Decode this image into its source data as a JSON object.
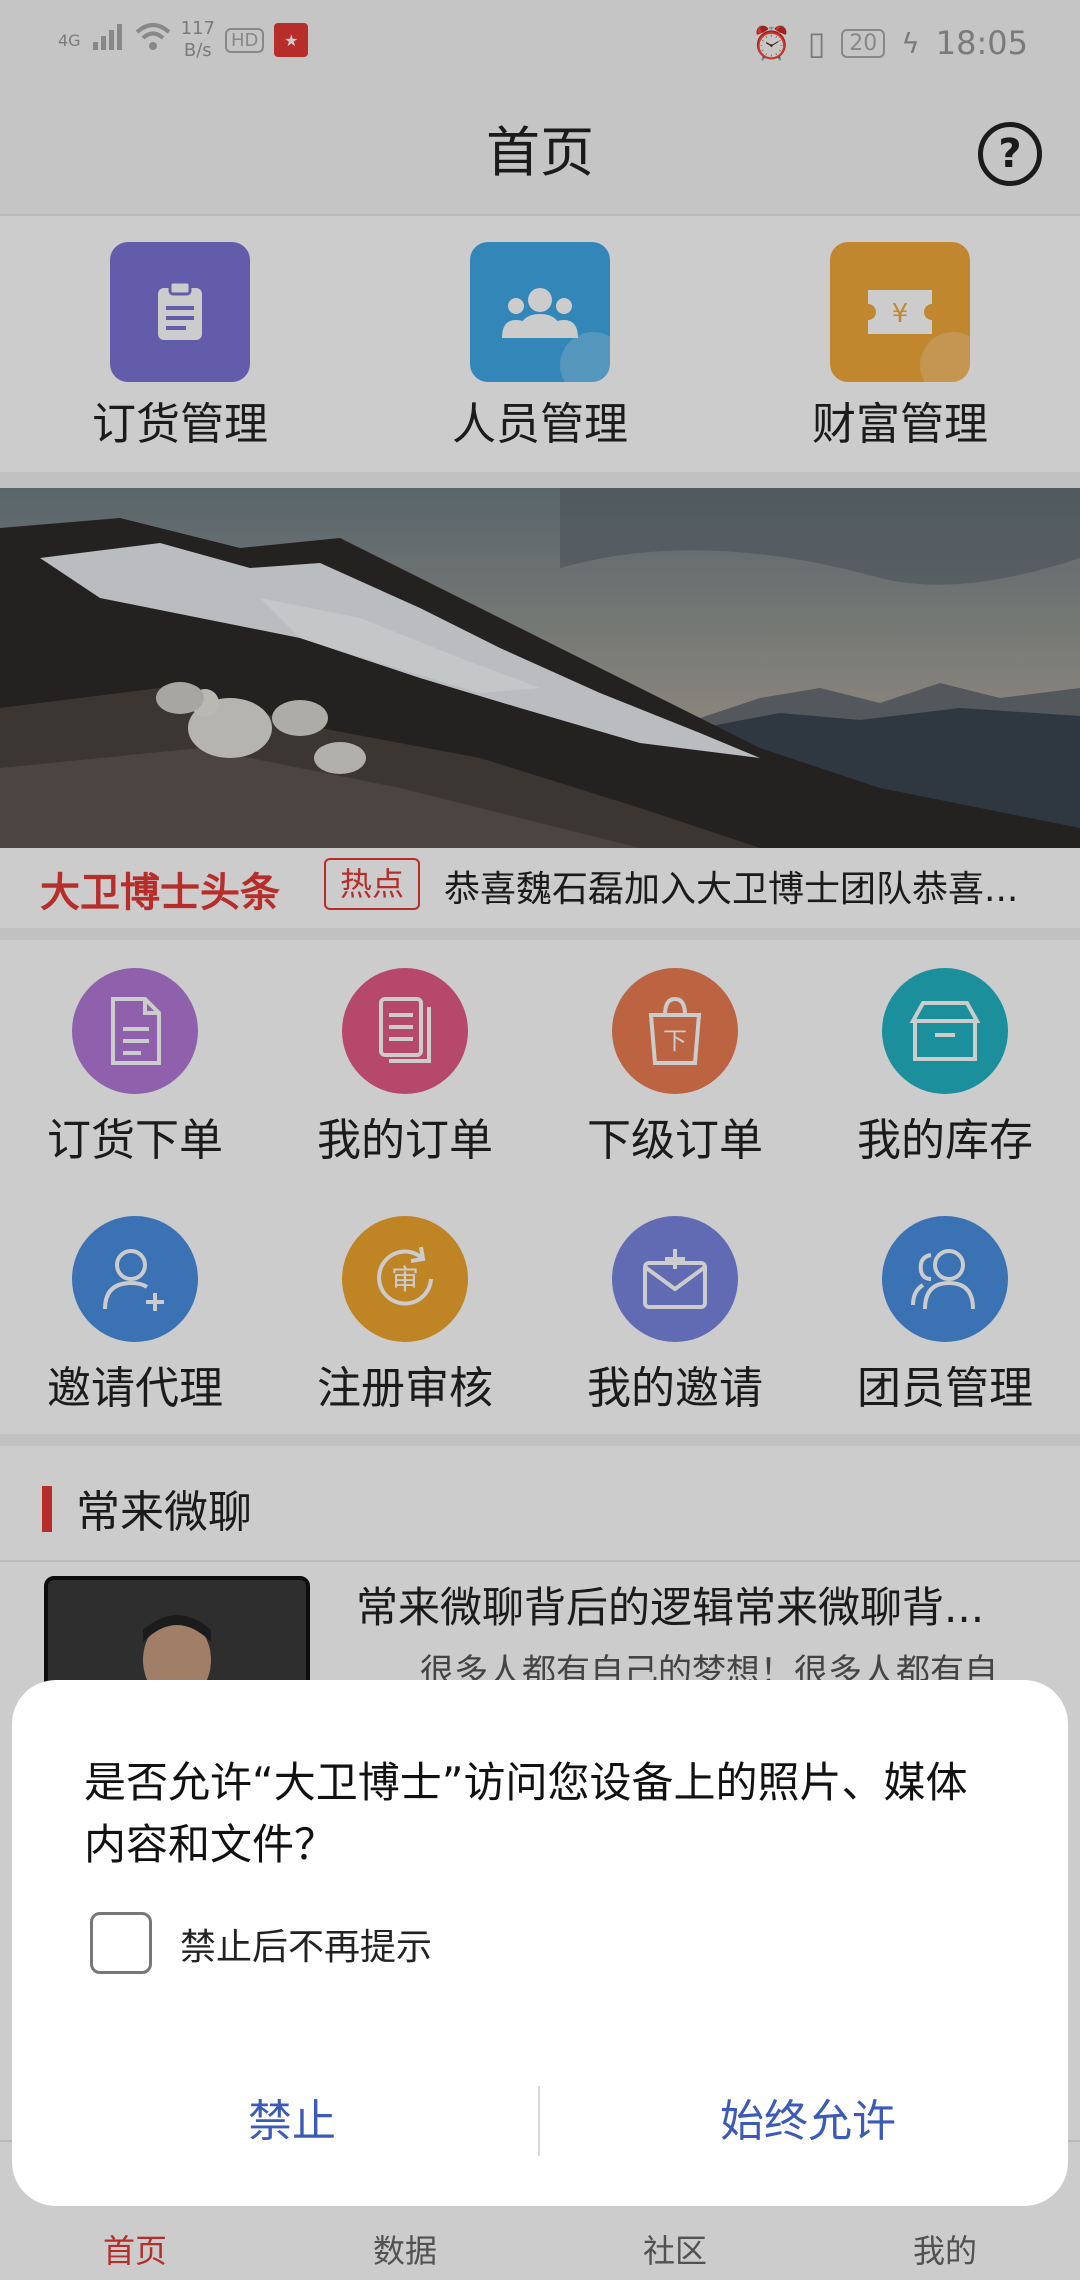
{
  "status_bar": {
    "network": "4G",
    "speed": "117",
    "speed_unit": "B/s",
    "hd": "HD",
    "battery": "20",
    "time": "18:05"
  },
  "header": {
    "title": "首页",
    "help_icon": "?"
  },
  "quick_menu": [
    {
      "label": "订货管理",
      "color": "#7b74d6",
      "icon": "clipboard-icon"
    },
    {
      "label": "人员管理",
      "color": "#3fa9e6",
      "icon": "people-icon"
    },
    {
      "label": "财富管理",
      "color": "#f2a93b",
      "icon": "ticket-yuan-icon"
    }
  ],
  "news": {
    "brand": "大卫博士头条",
    "tag": "热点",
    "text": "恭喜魏石磊加入大卫博士团队恭喜..."
  },
  "grid": [
    {
      "label": "订货下单",
      "color": "#b37ad9",
      "icon": "document-icon"
    },
    {
      "label": "我的订单",
      "color": "#e45b86",
      "icon": "documents-icon"
    },
    {
      "label": "下级订单",
      "color": "#ec7d52",
      "icon": "shopping-bag-icon"
    },
    {
      "label": "我的库存",
      "color": "#22b3c4",
      "icon": "box-icon"
    },
    {
      "label": "邀请代理",
      "color": "#4a8fe0",
      "icon": "add-user-icon"
    },
    {
      "label": "注册审核",
      "color": "#efa52e",
      "icon": "audit-icon"
    },
    {
      "label": "我的邀请",
      "color": "#7a86e0",
      "icon": "mail-plus-icon"
    },
    {
      "label": "团员管理",
      "color": "#4a8fe0",
      "icon": "team-icon"
    }
  ],
  "section": {
    "title": "常来微聊",
    "article_title": "常来微聊背后的逻辑常来微聊背...",
    "article_sub": "很多人都有自己的梦想！很多人都有自"
  },
  "bottom_nav": [
    {
      "label": "首页",
      "active": true
    },
    {
      "label": "数据",
      "active": false
    },
    {
      "label": "社区",
      "active": false
    },
    {
      "label": "我的",
      "active": false
    }
  ],
  "dialog": {
    "message": "是否允许“大卫博士”访问您设备上的照片、媒体内容和文件？",
    "checkbox_label": "禁止后不再提示",
    "deny": "禁止",
    "allow": "始终允许"
  }
}
